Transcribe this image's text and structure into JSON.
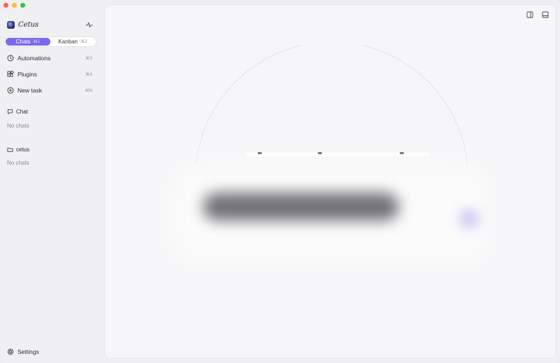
{
  "sidebar": {
    "brand": {
      "name": "Cetus"
    },
    "tabs": [
      {
        "label": "Chats",
        "shortcut": "⌘1",
        "active": true
      },
      {
        "label": "Kanban",
        "shortcut": "⌘2",
        "active": false
      }
    ],
    "nav": [
      {
        "label": "Automations",
        "shortcut": "⌘3",
        "icon": "clock-icon"
      },
      {
        "label": "Plugins",
        "shortcut": "⌘4",
        "icon": "plugins-icon"
      },
      {
        "label": "New task",
        "shortcut": "⌘N",
        "icon": "plus-circle-icon"
      }
    ],
    "sections": [
      {
        "title": "Chat",
        "icon": "chat-bubble-icon",
        "empty": "No chats"
      },
      {
        "title": "cetus",
        "icon": "folder-icon",
        "empty": "No chats"
      }
    ],
    "settings_label": "Settings"
  },
  "colors": {
    "accent": "#7a6ce8",
    "close": "#ff5f57",
    "minimize": "#febc2e",
    "maximize": "#28c840"
  }
}
